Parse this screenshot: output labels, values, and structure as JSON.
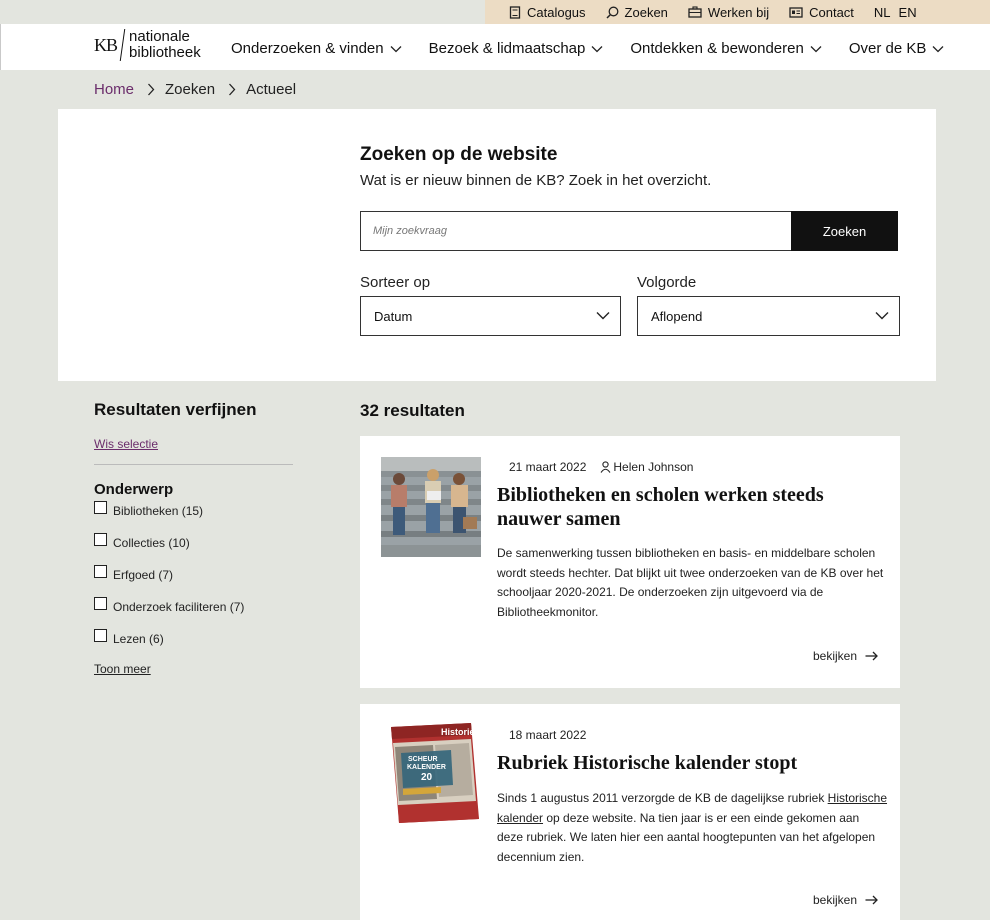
{
  "utility_bar": {
    "items": [
      {
        "label": "Catalogus",
        "icon": "book-icon"
      },
      {
        "label": "Zoeken",
        "icon": "search-icon"
      },
      {
        "label": "Werken bij",
        "icon": "briefcase-icon"
      },
      {
        "label": "Contact",
        "icon": "contact-card-icon"
      }
    ],
    "lang_nl": "NL",
    "lang_en": "EN"
  },
  "header": {
    "logo_mark": "KB",
    "logo_line1": "nationale",
    "logo_line2": "bibliotheek",
    "nav": [
      {
        "label": "Onderzoeken & vinden"
      },
      {
        "label": "Bezoek & lidmaatschap"
      },
      {
        "label": "Ontdekken & bewonderen"
      },
      {
        "label": "Over de KB"
      }
    ]
  },
  "breadcrumb": {
    "home": "Home",
    "items": [
      "Zoeken",
      "Actueel"
    ]
  },
  "search": {
    "title": "Zoeken op de website",
    "subtitle": "Wat is er nieuw binnen de KB? Zoek in het overzicht.",
    "placeholder": "Mijn zoekvraag",
    "button": "Zoeken",
    "sort_label": "Sorteer op",
    "sort_value": "Datum",
    "order_label": "Volgorde",
    "order_value": "Aflopend"
  },
  "filters": {
    "title": "Resultaten verfijnen",
    "clear": "Wis selectie",
    "group_title": "Onderwerp",
    "options": [
      {
        "label": "Bibliotheken (15)",
        "checked": false
      },
      {
        "label": "Collecties (10)",
        "checked": false
      },
      {
        "label": "Erfgoed (7)",
        "checked": false
      },
      {
        "label": "Onderzoek faciliteren (7)",
        "checked": false
      },
      {
        "label": "Lezen (6)",
        "checked": false
      }
    ],
    "more": "Toon meer"
  },
  "results": {
    "count": "32 resultaten",
    "items": [
      {
        "date": "21 maart 2022",
        "author": "Helen Johnson",
        "title": "Bibliotheken en scholen werken steeds nauwer samen",
        "text": "De samenwerking tussen bibliotheken en basis- en middelbare scholen wordt steeds hechter. Dat blijkt uit twee onderzoeken van de KB over het schooljaar 2020-2021. De onderzoeken zijn uitgevoerd via de Bibliotheekmonitor.",
        "link": "bekijken"
      },
      {
        "date": "18 maart 2022",
        "title": "Rubriek Historische kalender stopt",
        "text_before": "Sinds 1 augustus 2011 verzorgde de KB de dagelijkse rubriek ",
        "text_link": "Historische kalender",
        "text_after": " op deze website. Na tien jaar is er een einde gekomen aan deze rubriek. We laten hier een aantal hoogtepunten van het afgelopen decennium zien.",
        "link": "bekijken",
        "book_cover": {
          "brand": "Historie",
          "l1": "SCHEUR",
          "l2": "KALENDER",
          "l3": "20"
        }
      }
    ]
  }
}
